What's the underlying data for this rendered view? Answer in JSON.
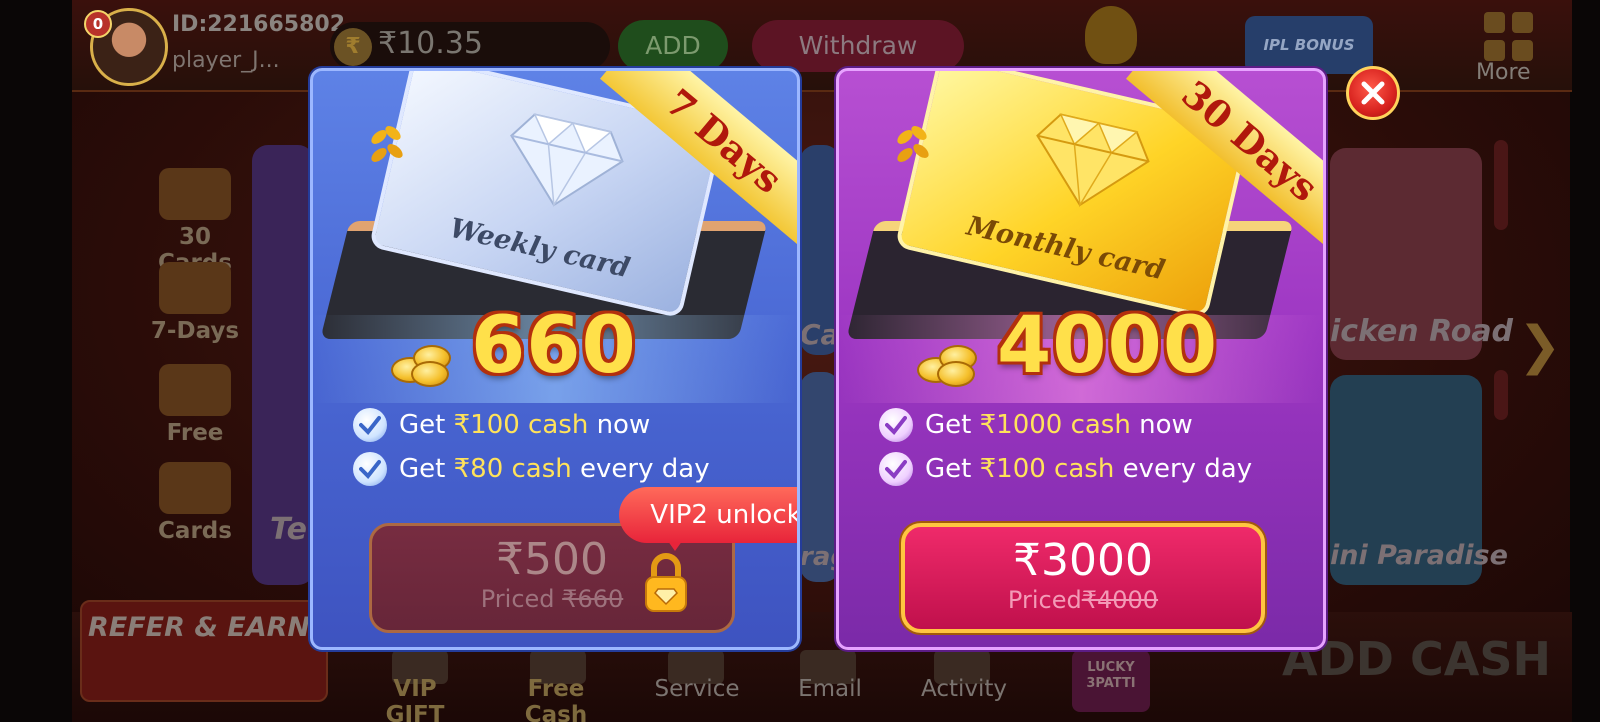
{
  "header": {
    "player_id": "ID:221665802",
    "player_name": "player_J...",
    "avatar_badge": "0",
    "balance": "₹10.35",
    "add_label": "ADD",
    "withdraw_label": "Withdraw",
    "ipl_badge": "IPL BONUS",
    "more_label": "More"
  },
  "side_menu": [
    {
      "label": "30 Cards"
    },
    {
      "label": "7-Days"
    },
    {
      "label": "Free"
    },
    {
      "label": "Cards"
    }
  ],
  "background_tiles": {
    "left_text": "Te",
    "mid_a": "Ca",
    "mid_b": "rag",
    "right_top": "icken Road",
    "right_bottom": "ini Paradise"
  },
  "bottom_nav": {
    "refer": "REFER & EARN",
    "vip_gift": "VIP GIFT",
    "free_cash": "Free Cash",
    "service": "Service",
    "email": "Email",
    "activity": "Activity",
    "lucky_top": "LUCKY",
    "lucky_bottom": "3PATTI",
    "add_cash": "ADD CASH"
  },
  "weekly": {
    "ribbon": "7 Days",
    "card_label": "Weekly card",
    "amount": "660",
    "benefit1_pre": "Get ",
    "benefit1_hl": "₹100 cash",
    "benefit1_post": " now",
    "benefit2_pre": "Get ",
    "benefit2_hl": "₹80 cash",
    "benefit2_post": " every day",
    "price": "₹500",
    "priced_label": "Priced ",
    "priced_value": "₹660",
    "locked": true,
    "unlock_tip": "VIP2 unlock"
  },
  "monthly": {
    "ribbon": "30 Days",
    "card_label": "Monthly card",
    "amount": "4000",
    "benefit1_pre": "Get ",
    "benefit1_hl": "₹1000 cash",
    "benefit1_post": " now",
    "benefit2_pre": "Get ",
    "benefit2_hl": "₹100 cash",
    "benefit2_post": " every day",
    "price": "₹3000",
    "priced_label": "Priced",
    "priced_value": "₹4000"
  },
  "colors": {
    "weekly_panel": "#4a68d4",
    "monthly_panel": "#9c36c2",
    "amount_gold": "#ffe04a",
    "highlight": "#ffe25a",
    "buy_button": "#e0205e"
  },
  "icons": [
    "avatar",
    "rupee-coin-icon",
    "pot-icon",
    "more-grid-icon",
    "diamond-icon",
    "coins-icon",
    "check-icon",
    "lock-icon",
    "close-icon"
  ]
}
